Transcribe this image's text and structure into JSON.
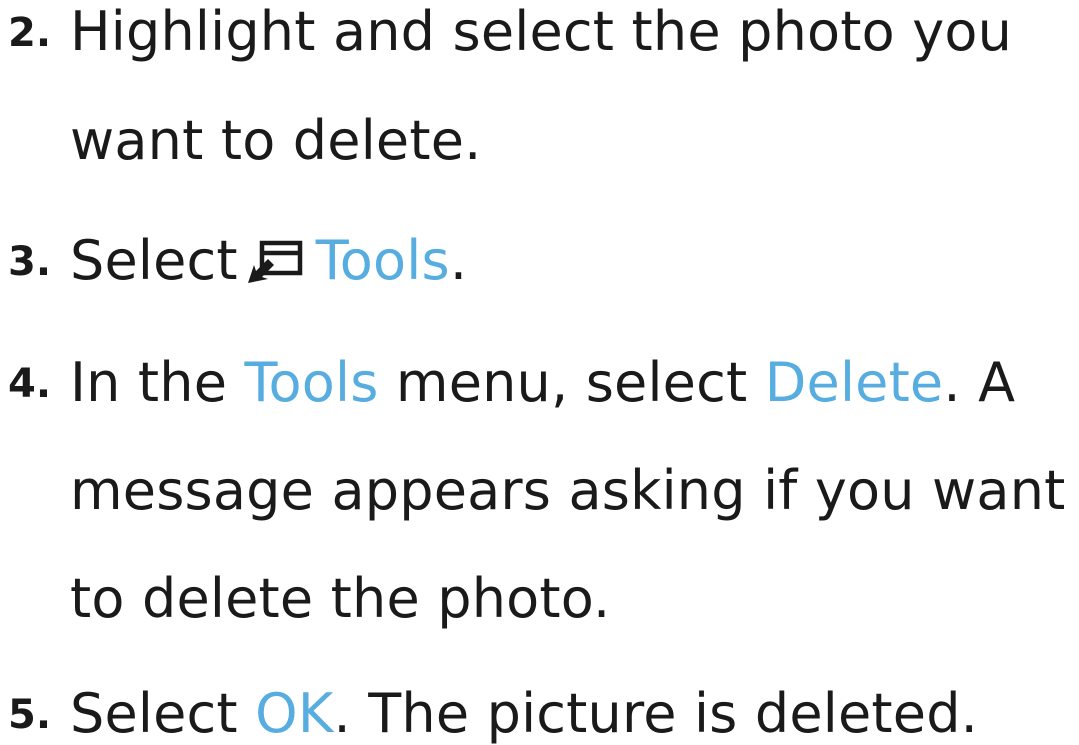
{
  "steps": [
    {
      "number": "2.",
      "lines": [
        "Highlight and select the photo you",
        "want to delete."
      ]
    },
    {
      "number": "3.",
      "prefix": "Select",
      "icon": "tools-icon",
      "keyword": "Tools",
      "suffix": "."
    },
    {
      "number": "4.",
      "line1": {
        "t1": "In the ",
        "k1": "Tools",
        "t2": " menu, select ",
        "k2": "Delete",
        "t3": ". A"
      },
      "line2": "message appears asking if you want",
      "line3": "to delete the photo."
    },
    {
      "number": "5.",
      "t1": "Select ",
      "k1": "OK",
      "t2": ". The picture is deleted."
    }
  ],
  "colors": {
    "text": "#1a1a1a",
    "highlight": "#58ade0"
  }
}
